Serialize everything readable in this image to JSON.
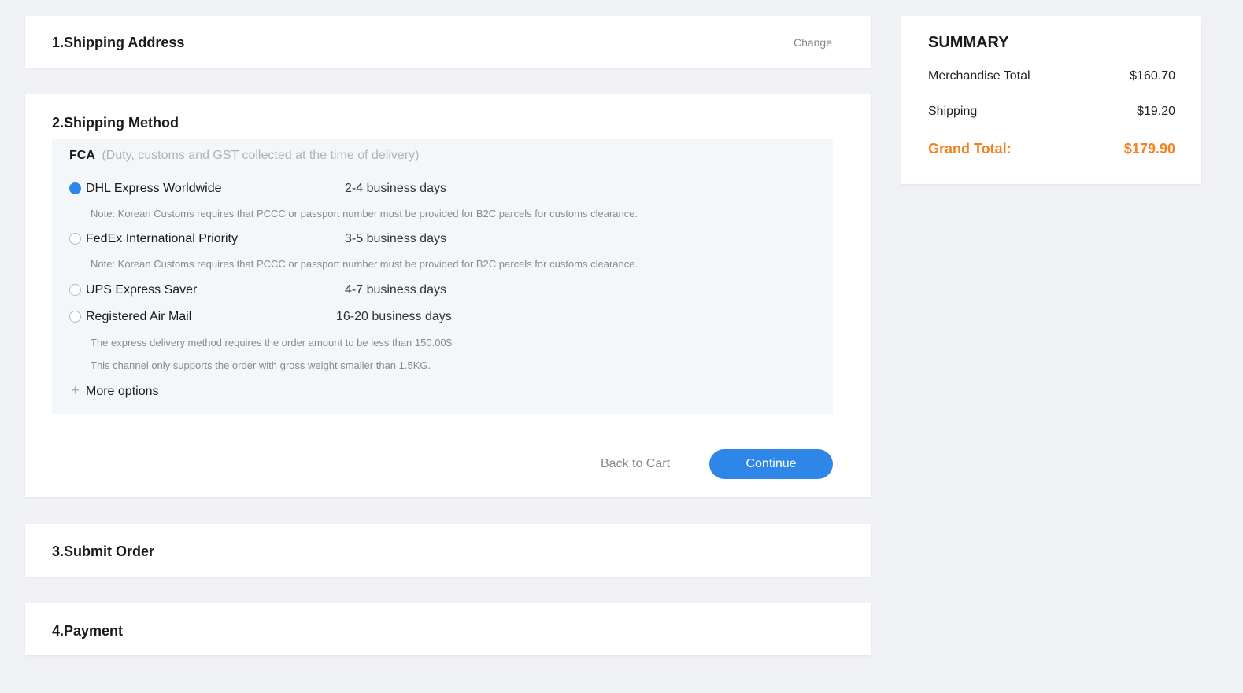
{
  "shipping_address": {
    "title": "1.Shipping Address",
    "change_label": "Change"
  },
  "shipping_method": {
    "title": "2.Shipping Method",
    "fca_code": "FCA",
    "fca_desc": "(Duty, customs and GST collected at the time of delivery)",
    "options": [
      {
        "name": "DHL Express Worldwide",
        "days": "2-4 business days",
        "selected": true
      },
      {
        "name": "FedEx International Priority",
        "days": "3-5 business days",
        "selected": false
      },
      {
        "name": "UPS Express Saver",
        "days": "4-7 business days",
        "selected": false
      },
      {
        "name": "Registered Air Mail",
        "days": "16-20 business days",
        "selected": false
      }
    ],
    "notes": {
      "dhl": "Note: Korean Customs requires that PCCC or passport number must be provided for B2C parcels for customs clearance.",
      "fedex": "Note: Korean Customs requires that PCCC or passport number must be provided for B2C parcels for customs clearance.",
      "airmail_1": "The express delivery method requires the order amount to be less than 150.00$",
      "airmail_2": "This channel only supports the order with gross weight smaller than 1.5KG."
    },
    "more_options": "More options",
    "back_label": "Back to Cart",
    "continue_label": "Continue"
  },
  "submit_order": {
    "title": "3.Submit Order"
  },
  "payment": {
    "title": "4.Payment"
  },
  "summary": {
    "title": "SUMMARY",
    "merchandise_label": "Merchandise Total",
    "merchandise_value": "$160.70",
    "shipping_label": "Shipping",
    "shipping_value": "$19.20",
    "grand_label": "Grand Total:",
    "grand_value": "$179.90"
  },
  "colors": {
    "accent": "#2e87e8",
    "grand_total": "#f58220",
    "page_background": "#f0f1f5",
    "panel_background": "#f3f7fa"
  }
}
